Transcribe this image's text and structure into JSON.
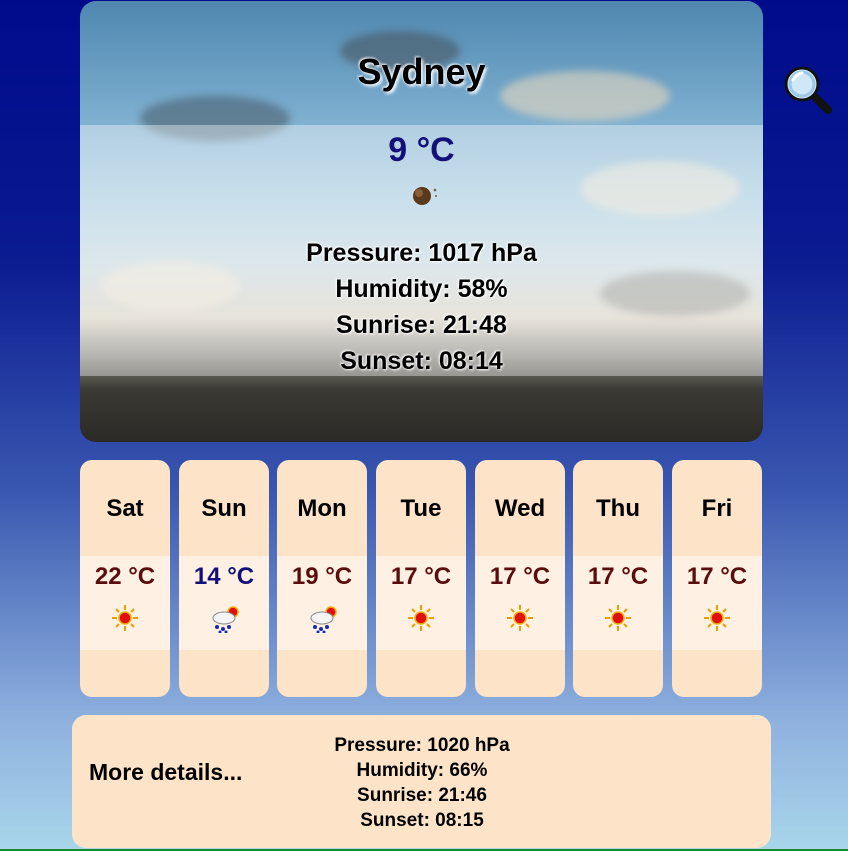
{
  "current": {
    "city": "Sydney",
    "temperature": "9 °C",
    "icon": "moon-night-icon",
    "details": {
      "pressure": "Pressure: 1017 hPa",
      "humidity": "Humidity: 58%",
      "sunrise": "Sunrise: 21:48",
      "sunset": "Sunset: 08:14"
    }
  },
  "forecast": [
    {
      "day": "Sat",
      "temp": "22 °C",
      "icon": "sun-icon"
    },
    {
      "day": "Sun",
      "temp": "14 °C",
      "icon": "rain-sun-icon"
    },
    {
      "day": "Mon",
      "temp": "19 °C",
      "icon": "rain-sun-icon"
    },
    {
      "day": "Tue",
      "temp": "17 °C",
      "icon": "sun-icon"
    },
    {
      "day": "Wed",
      "temp": "17 °C",
      "icon": "sun-icon"
    },
    {
      "day": "Thu",
      "temp": "17 °C",
      "icon": "sun-icon"
    },
    {
      "day": "Fri",
      "temp": "17 °C",
      "icon": "sun-icon"
    }
  ],
  "more": {
    "link": "More details...",
    "pressure": "Pressure: 1020 hPa",
    "humidity": "Humidity: 66%",
    "sunrise": "Sunrise: 21:46",
    "sunset": "Sunset: 08:15"
  },
  "colors": {
    "card": "#fde4c8",
    "warm_temp": "#5a0d0d",
    "cold_temp": "#12107a"
  }
}
